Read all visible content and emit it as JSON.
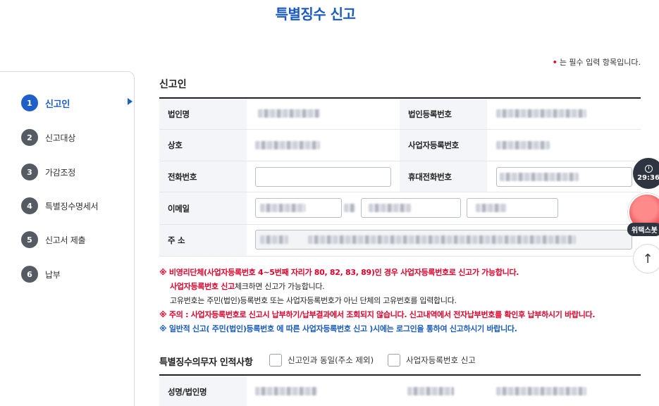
{
  "page": {
    "title": "특별징수 신고"
  },
  "required_note": {
    "dot": "•",
    "text": "는 필수 입력 항목입니다."
  },
  "steps": [
    {
      "num": "1",
      "label": "신고인",
      "active": true
    },
    {
      "num": "2",
      "label": "신고대상"
    },
    {
      "num": "3",
      "label": "가감조정"
    },
    {
      "num": "4",
      "label": "특별징수명세서"
    },
    {
      "num": "5",
      "label": "신고서 제출"
    },
    {
      "num": "6",
      "label": "납부"
    }
  ],
  "section": {
    "title": "신고인"
  },
  "form": {
    "corp_name_label": "법인명",
    "corp_reg_no_label": "법인등록번호",
    "trade_name_label": "상호",
    "biz_reg_no_label": "사업자등록번호",
    "phone_label": "전화번호",
    "phone_value": "",
    "mobile_label": "휴대전화번호",
    "email_label": "이메일",
    "address_label": "주 소"
  },
  "notices": {
    "line1": "※ 비영리단체(사업자등록번호 4~5번째 자리가 80, 82, 83, 89)인 경우 사업자등록번호로 신고가 가능합니다.",
    "line2_em": "사업자등록번호 신고",
    "line2_rest": "체크하면 신고가 가능합니다.",
    "line3": "고유번호는 주민(법인)등록번호 또는 사업자등록번호가 아닌 단체의 고유번호를 입력합니다.",
    "line4": "※ 주의 : 사업자등록번호로 신고시 납부하기/납부결과에서 조회되지 않습니다. 신고내역에서 전자납부번호를 확인후 납부하시기 바랍니다.",
    "line5": "※ 일반적 신고( 주민(법인)등록번호 에 따른 사업자등록번호 신고 )시에는 로그인을 통하여 신고하시기 바랍니다."
  },
  "section2": {
    "title": "특별징수의무자 인적사항",
    "check1": "신고인과 동일(주소 제외)",
    "check2": "사업자등록번호 신고",
    "name_label": "성명/법인명"
  },
  "widgets": {
    "timer": "29:36",
    "mascot_label": "위택스봇",
    "scroll_top": "↑"
  },
  "colors": {
    "accent": "#1e5fc8",
    "title": "#1a5bbf",
    "warning": "#e4002b"
  }
}
